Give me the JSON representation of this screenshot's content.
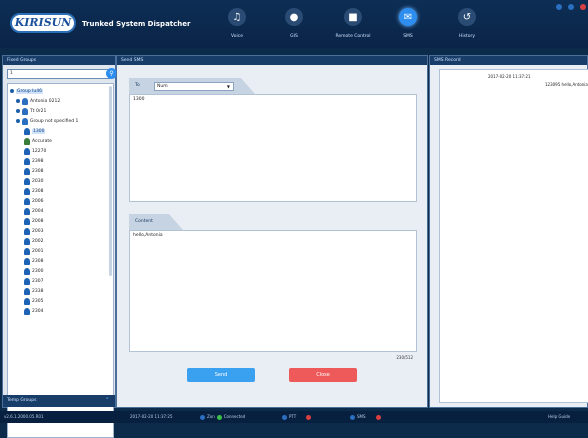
{
  "app": {
    "logo_text": "KIRISUN",
    "title": "Trunked System Dispatcher"
  },
  "nav": [
    {
      "label": "Voice",
      "icon": "microphone-icon"
    },
    {
      "label": "GIS",
      "icon": "map-pin-icon"
    },
    {
      "label": "Remote Control",
      "icon": "remote-control-icon"
    },
    {
      "label": "SMS",
      "icon": "message-icon"
    },
    {
      "label": "History",
      "icon": "history-icon"
    }
  ],
  "left": {
    "header": "Fixed Groups",
    "search_value": "1",
    "tree": {
      "root": "Group lu46",
      "groups": [
        "Antonia 0212",
        "Tt 0r21",
        "Group not specified 1"
      ],
      "selected_user": "1300",
      "members": [
        "Accurate",
        "12270",
        "2398",
        "2308",
        "2030",
        "2308",
        "2006",
        "2004",
        "2008",
        "2003",
        "2002",
        "2001",
        "2308",
        "2300",
        "2307",
        "2338",
        "2305",
        "2304"
      ]
    },
    "temp_header": "Temp Groups"
  },
  "compose": {
    "header": "Send SMS",
    "to_label": "To",
    "to_type": "Num",
    "to_value": "1300",
    "content_label": "Content",
    "content_value": "hello,Antonia",
    "char_count": "230/512",
    "send_label": "Send",
    "close_label": "Close"
  },
  "record": {
    "header": "SMS Record",
    "timestamp": "2017-02-20 11:37:21",
    "message": "123095 hello,Antonia"
  },
  "status": {
    "version": "v2.6.1.2000.05.R01",
    "datetime": "2017-02-20 11:37:25",
    "zone_label": "Zon",
    "connect_label": "Connected",
    "ptt_label": "PTT",
    "sms_label": "SMS",
    "help_label": "Help Guide"
  },
  "colors": {
    "accent": "#2d8ef0",
    "send": "#3aa0f0",
    "close": "#ee5a5a",
    "header": "#183d68"
  }
}
